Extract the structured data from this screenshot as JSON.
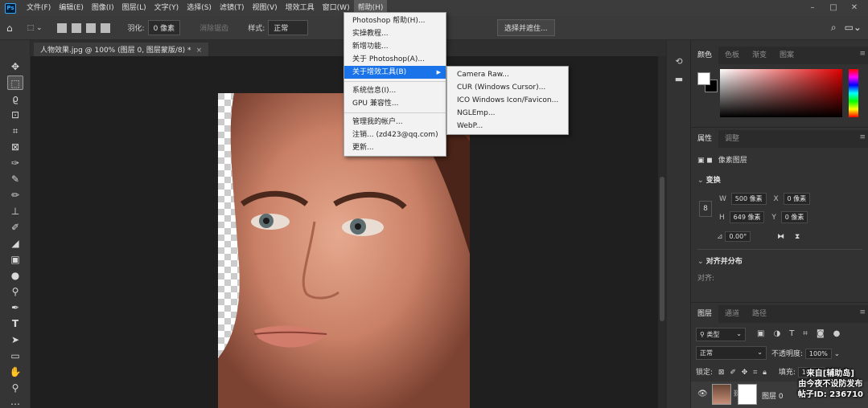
{
  "menubar": {
    "logo": "Ps",
    "items": [
      "文件(F)",
      "编辑(E)",
      "图像(I)",
      "图层(L)",
      "文字(Y)",
      "选择(S)",
      "滤镜(T)",
      "视图(V)",
      "增效工具",
      "窗口(W)",
      "帮助(H)"
    ],
    "window_controls": [
      "–",
      "□",
      "✕"
    ]
  },
  "optbar": {
    "feather_label": "羽化:",
    "feather_value": "0 像素",
    "antialias_label": "消除锯齿",
    "style_label": "样式:",
    "style_value": "正常",
    "select_mask_button": "选择并遮住..."
  },
  "document": {
    "tab_title": "人物效果.jpg @ 100% (图层 0, 图层蒙版/8) *"
  },
  "help_menu": {
    "items": [
      {
        "label": "Photoshop 帮助(H)..."
      },
      {
        "label": "实操教程..."
      },
      {
        "label": "新增功能..."
      },
      {
        "label": "关于 Photoshop(A)..."
      },
      {
        "label": "关于增效工具(B)"
      },
      {
        "label": "系统信息(I)..."
      },
      {
        "label": "GPU 兼容性..."
      },
      {
        "label": "管理我的帐户..."
      },
      {
        "label": "注销... (zd423@qq.com)"
      },
      {
        "label": "更新..."
      }
    ]
  },
  "plugin_submenu": {
    "items": [
      "Camera Raw...",
      "CUR (Windows Cursor)...",
      "ICO Windows Icon/Favicon...",
      "NGLEmp...",
      "WebP..."
    ]
  },
  "color_panel": {
    "tabs": [
      "颜色",
      "色板",
      "渐变",
      "图案"
    ],
    "accent_color": "#1a73e8",
    "foreground_color": "#ffffff",
    "background_color": "#000000"
  },
  "properties_panel": {
    "tabs": [
      "属性",
      "调整"
    ],
    "layer_type": "像素图层",
    "transform_title": "变换",
    "w_label": "W",
    "w_value": "500 像素",
    "x_label": "X",
    "x_value": "0 像素",
    "h_label": "H",
    "h_value": "649 像素",
    "y_label": "Y",
    "y_value": "0 像素",
    "angle_value": "0.00°",
    "align_title": "对齐并分布",
    "align_label": "对齐:"
  },
  "layers_panel": {
    "tabs": [
      "图层",
      "通道",
      "路径"
    ],
    "filter_label": "类型",
    "blend_mode": "正常",
    "opacity_label": "不透明度:",
    "opacity_value": "100%",
    "lock_label": "锁定:",
    "fill_label": "填充:",
    "fill_value": "100%",
    "layer_name": "图层 0"
  },
  "watermark": {
    "line1": "来自[辅助岛]",
    "line2": "由今夜不设防发布",
    "line3": "帖子ID: 236710"
  }
}
